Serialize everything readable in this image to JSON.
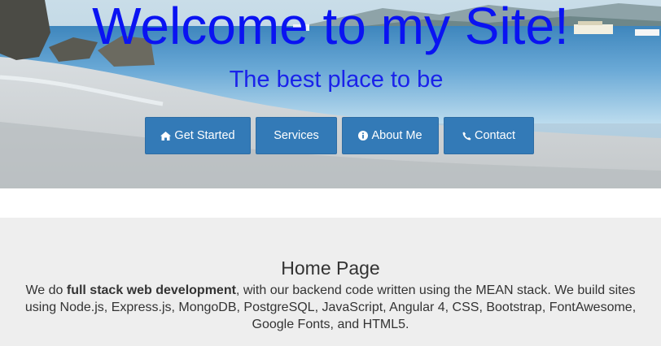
{
  "hero": {
    "title": "Welcome to my Site!",
    "subtitle": "The best place to be",
    "title_color": "#0a13f2",
    "buttons": [
      {
        "label": "Get Started",
        "icon": "home-icon"
      },
      {
        "label": "Services",
        "icon": ""
      },
      {
        "label": "About Me",
        "icon": "info-circle-icon"
      },
      {
        "label": "Contact",
        "icon": "phone-icon"
      }
    ],
    "button_color": "#337ab7"
  },
  "home": {
    "title": "Home Page",
    "text_before": "We do ",
    "text_bold": "full stack web development",
    "text_after": ", with our backend code written using the MEAN stack. We build sites using Node.js, Express.js, MongoDB, PostgreSQL, JavaScript, Angular 4, CSS, Bootstrap, FontAwesome, Google Fonts, and HTML5."
  }
}
